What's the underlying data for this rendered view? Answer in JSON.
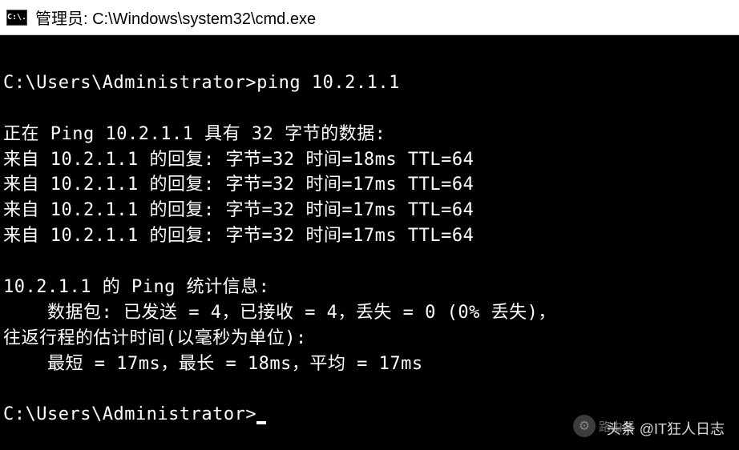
{
  "titlebar": {
    "icon_text": "C:\\.",
    "title": "管理员: C:\\Windows\\system32\\cmd.exe"
  },
  "terminal": {
    "prompt1_path": "C:\\Users\\Administrator>",
    "command": "ping 10.2.1.1",
    "pinging_line": "正在 Ping 10.2.1.1 具有 32 字节的数据:",
    "replies": [
      "来自 10.2.1.1 的回复: 字节=32 时间=18ms TTL=64",
      "来自 10.2.1.1 的回复: 字节=32 时间=17ms TTL=64",
      "来自 10.2.1.1 的回复: 字节=32 时间=17ms TTL=64",
      "来自 10.2.1.1 的回复: 字节=32 时间=17ms TTL=64"
    ],
    "stats_header": "10.2.1.1 的 Ping 统计信息:",
    "stats_packets": "    数据包: 已发送 = 4，已接收 = 4，丢失 = 0 (0% 丢失)，",
    "rtt_header": "往返行程的估计时间(以毫秒为单位):",
    "rtt_values": "    最短 = 17ms，最长 = 18ms，平均 = 17ms",
    "prompt2_path": "C:\\Users\\Administrator>"
  },
  "watermarks": {
    "primary": "头条 @IT狂人日志",
    "secondary": "路由器"
  }
}
